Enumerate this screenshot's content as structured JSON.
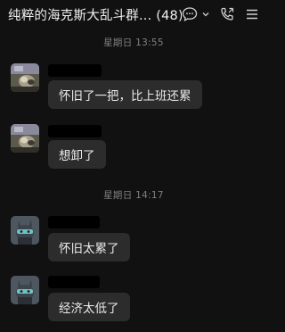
{
  "header": {
    "title": "纯粹的海克斯大乱斗群... (48)",
    "icons": [
      "chat-bubble-icon",
      "chevron-down-icon",
      "phone-icon",
      "menu-icon"
    ]
  },
  "timestamps": [
    "星期日 13:55",
    "星期日 14:17"
  ],
  "messages": [
    {
      "avatar": "photo-avatar",
      "sender_name": "",
      "text": "怀旧了一把，比上班还累"
    },
    {
      "avatar": "photo-avatar",
      "sender_name": "",
      "text": "想卸了"
    },
    {
      "avatar": "cartoon-avatar",
      "sender_name": "",
      "text": "怀旧太累了"
    },
    {
      "avatar": "cartoon-avatar",
      "sender_name": "",
      "text": "经济太低了"
    }
  ],
  "colors": {
    "background": "#111111",
    "bubble": "#2c2c2c",
    "timestamp": "#7f7f7f"
  }
}
